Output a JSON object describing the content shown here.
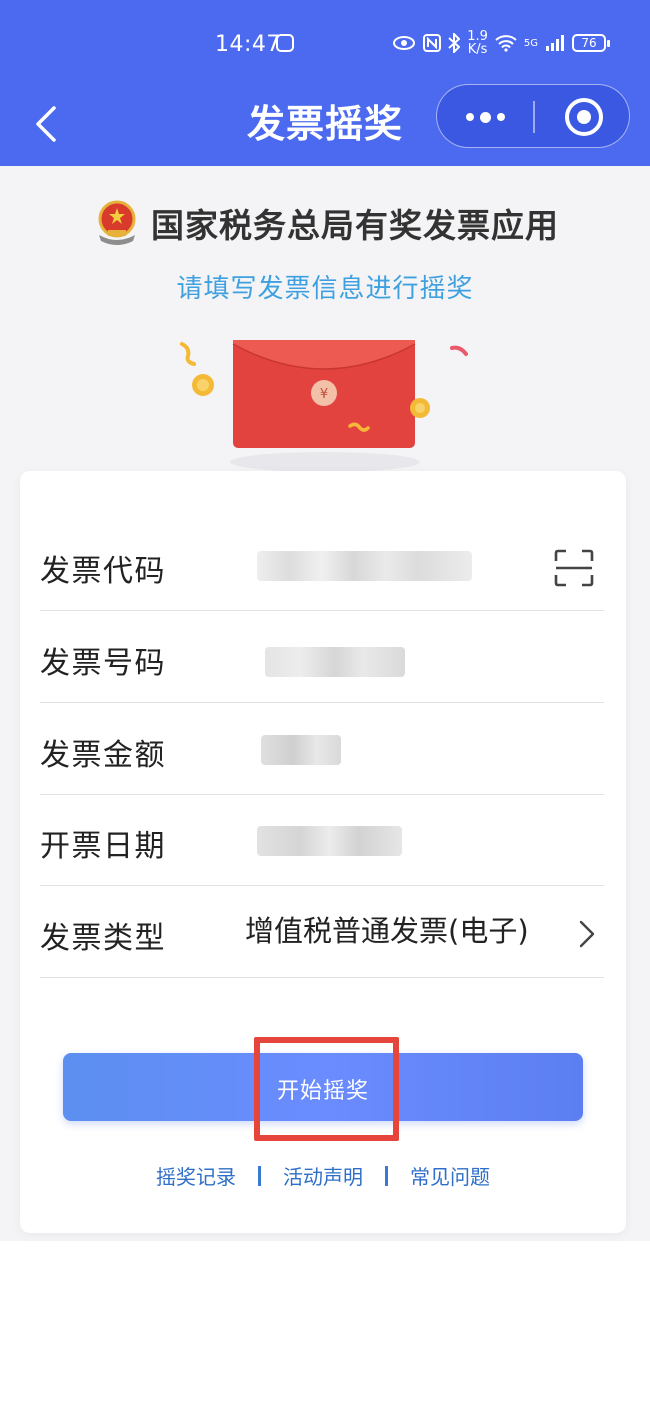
{
  "status_bar": {
    "time": "14:47",
    "net_speed_value": "1.9",
    "net_speed_unit": "K/s",
    "signal_label": "5G",
    "battery": "76"
  },
  "navbar": {
    "title": "发票摇奖"
  },
  "header": {
    "title": "国家税务总局有奖发票应用",
    "subtitle": "请填写发票信息进行摇奖"
  },
  "form": {
    "rows": [
      {
        "label": "发票代码",
        "value": ""
      },
      {
        "label": "发票号码",
        "value": ""
      },
      {
        "label": "发票金额",
        "value": ""
      },
      {
        "label": "开票日期",
        "value": ""
      },
      {
        "label": "发票类型",
        "value": "增值税普通发票(电子)"
      }
    ]
  },
  "actions": {
    "start_label": "开始摇奖",
    "links": [
      "摇奖记录",
      "活动声明",
      "常见问题"
    ]
  },
  "colors": {
    "brand_blue": "#4b6af0",
    "link_blue": "#2f6fc9",
    "subtitle_blue": "#3fa0e0",
    "highlight_red": "#e5453a",
    "envelope_red": "#e2433f"
  },
  "icons": {
    "back": "chevron-left-icon",
    "more": "more-dots-icon",
    "close": "target-circle-icon",
    "scan": "scan-icon",
    "type_arrow": "chevron-right-icon"
  }
}
